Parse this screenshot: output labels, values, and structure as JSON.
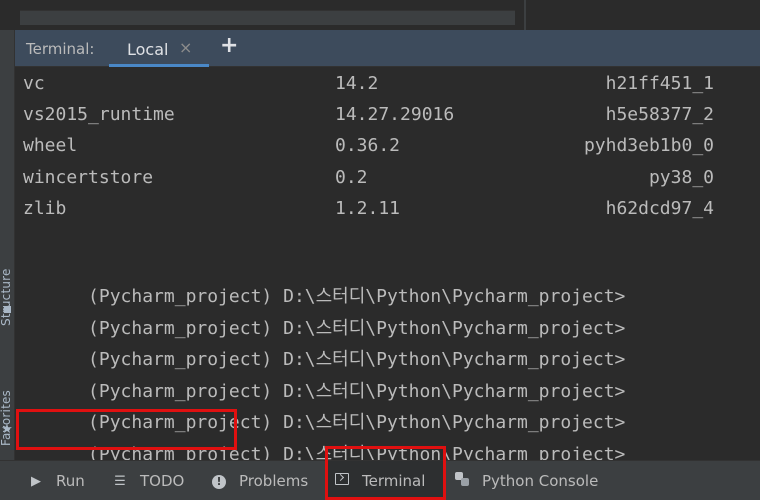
{
  "stripe": {
    "structure_label": "Structure",
    "favorites_label": "Favorites"
  },
  "terminal": {
    "title": "Terminal:",
    "tab_label": "Local",
    "close_glyph": "×",
    "add_glyph": "+"
  },
  "packages": [
    {
      "name": "vc",
      "version": "14.2",
      "build": "h21ff451_1"
    },
    {
      "name": "vs2015_runtime",
      "version": "14.27.29016",
      "build": "h5e58377_2"
    },
    {
      "name": "wheel",
      "version": "0.36.2",
      "build": "pyhd3eb1b0_0"
    },
    {
      "name": "wincertstore",
      "version": "0.2",
      "build": "py38_0"
    },
    {
      "name": "zlib",
      "version": "1.2.11",
      "build": "h62dcd97_4"
    }
  ],
  "prompts": [
    {
      "env": "(Pycharm_project)",
      "path": " D:\\스터디\\Python\\Pycharm_project>"
    },
    {
      "env": "(Pycharm_project)",
      "path": " D:\\스터디\\Python\\Pycharm_project>"
    },
    {
      "env": "(Pycharm_project)",
      "path": " D:\\스터디\\Python\\Pycharm_project>"
    },
    {
      "env": "(Pycharm_project)",
      "path": " D:\\스터디\\Python\\Pycharm_project>"
    },
    {
      "env": "(Pycharm_project)",
      "path": " D:\\스터디\\Python\\Pycharm_project>"
    },
    {
      "env": "(Pycharm_project)",
      "path": " D:\\스터디\\Python\\Pycharm_project>"
    }
  ],
  "toolbar": {
    "run": "Run",
    "todo": "TODO",
    "problems": "Problems",
    "terminal": "Terminal",
    "python_console": "Python Console",
    "run_icon": "play-icon",
    "todo_icon": "list-icon",
    "problems_icon": "info-icon",
    "terminal_icon": "terminal-icon",
    "python_icon": "python-icon"
  },
  "colors": {
    "background": "#2b2b2b",
    "header": "#3d4b5c",
    "tab_underline": "#4a88c7",
    "highlight": "#e01010",
    "text": "#bbbbbb"
  }
}
